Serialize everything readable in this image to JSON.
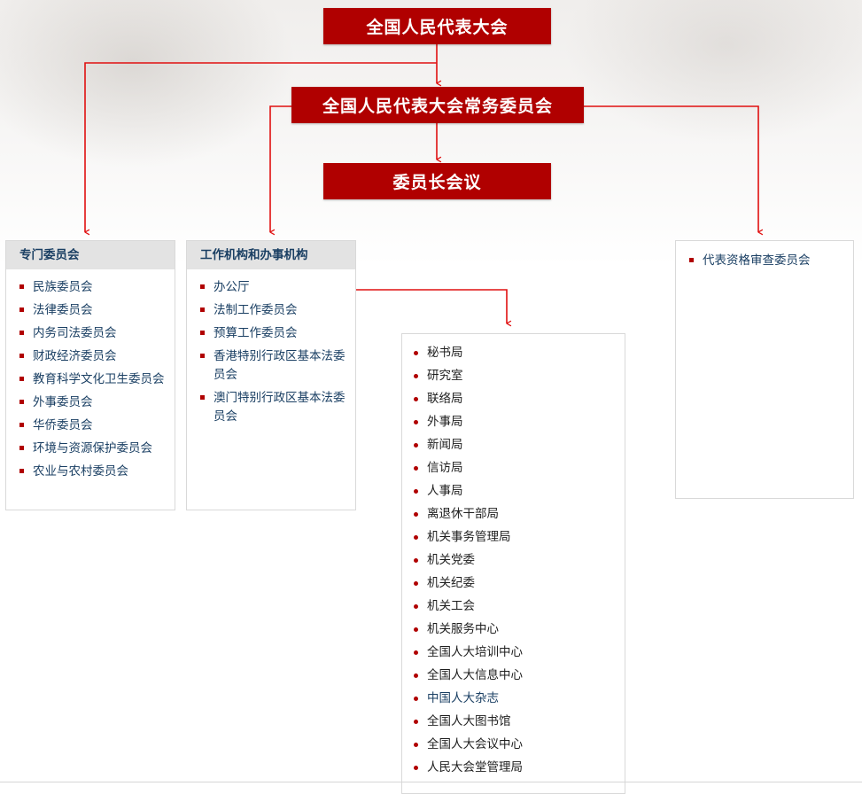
{
  "top": {
    "npc": "全国人民代表大会",
    "standing_committee": "全国人民代表大会常务委员会",
    "chairmen_council": "委员长会议"
  },
  "special_committees": {
    "title": "专门委员会",
    "items": [
      "民族委员会",
      "法律委员会",
      "内务司法委员会",
      "财政经济委员会",
      "教育科学文化卫生委员会",
      "外事委员会",
      "华侨委员会",
      "环境与资源保护委员会",
      "农业与农村委员会"
    ]
  },
  "working_bodies": {
    "title": "工作机构和办事机构",
    "items": [
      "办公厅",
      "法制工作委员会",
      "预算工作委员会",
      "香港特别行政区基本法委员会",
      "澳门特别行政区基本法委员会"
    ]
  },
  "qualification": {
    "items": [
      "代表资格审查委员会"
    ]
  },
  "general_office_departments": {
    "items": [
      "秘书局",
      "研究室",
      "联络局",
      "外事局",
      "新闻局",
      "信访局",
      "人事局",
      "离退休干部局",
      "机关事务管理局",
      "机关党委",
      "机关纪委",
      "机关工会",
      "机关服务中心",
      "全国人大培训中心",
      "全国人大信息中心",
      "中国人大杂志",
      "全国人大图书馆",
      "全国人大会议中心",
      "人民大会堂管理局"
    ]
  },
  "colors": {
    "box_red": "#b00000",
    "connector_red": "#e01010",
    "link_blue": "#1a3f63",
    "header_gray": "#e3e3e3"
  }
}
